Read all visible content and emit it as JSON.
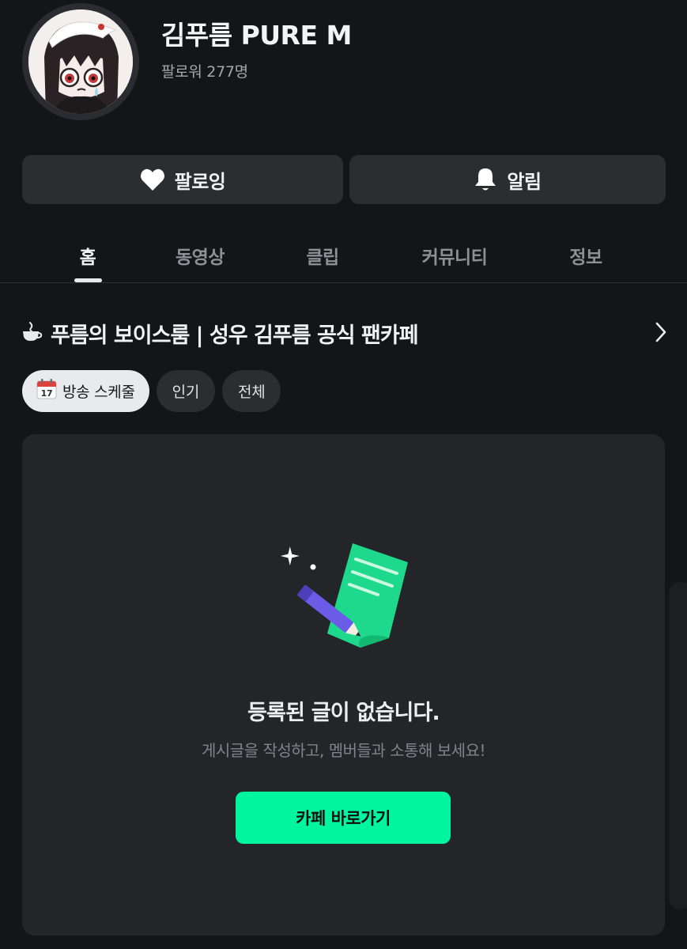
{
  "profile": {
    "name": "김푸름 PURE M",
    "followers": "팔로워 277명"
  },
  "actions": {
    "follow_label": "팔로잉",
    "alarm_label": "알림"
  },
  "tabs": [
    {
      "label": "홈",
      "active": true
    },
    {
      "label": "동영상",
      "active": false
    },
    {
      "label": "클립",
      "active": false
    },
    {
      "label": "커뮤니티",
      "active": false
    },
    {
      "label": "정보",
      "active": false
    }
  ],
  "cafe": {
    "title": "푸름의 보이스룸 | 성우 김푸름 공식 팬카페",
    "chips": [
      {
        "label": "방송 스케줄",
        "active": true
      },
      {
        "label": "인기",
        "active": false
      },
      {
        "label": "전체",
        "active": false
      }
    ],
    "calendar_day": "17"
  },
  "empty_state": {
    "title": "등록된 글이 없습니다.",
    "description": "게시글을 작성하고, 멤버들과 소통해 보세요!",
    "button_label": "카페 바로가기"
  },
  "colors": {
    "background": "#141517",
    "card": "#242529",
    "accent": "#00f5a0"
  }
}
